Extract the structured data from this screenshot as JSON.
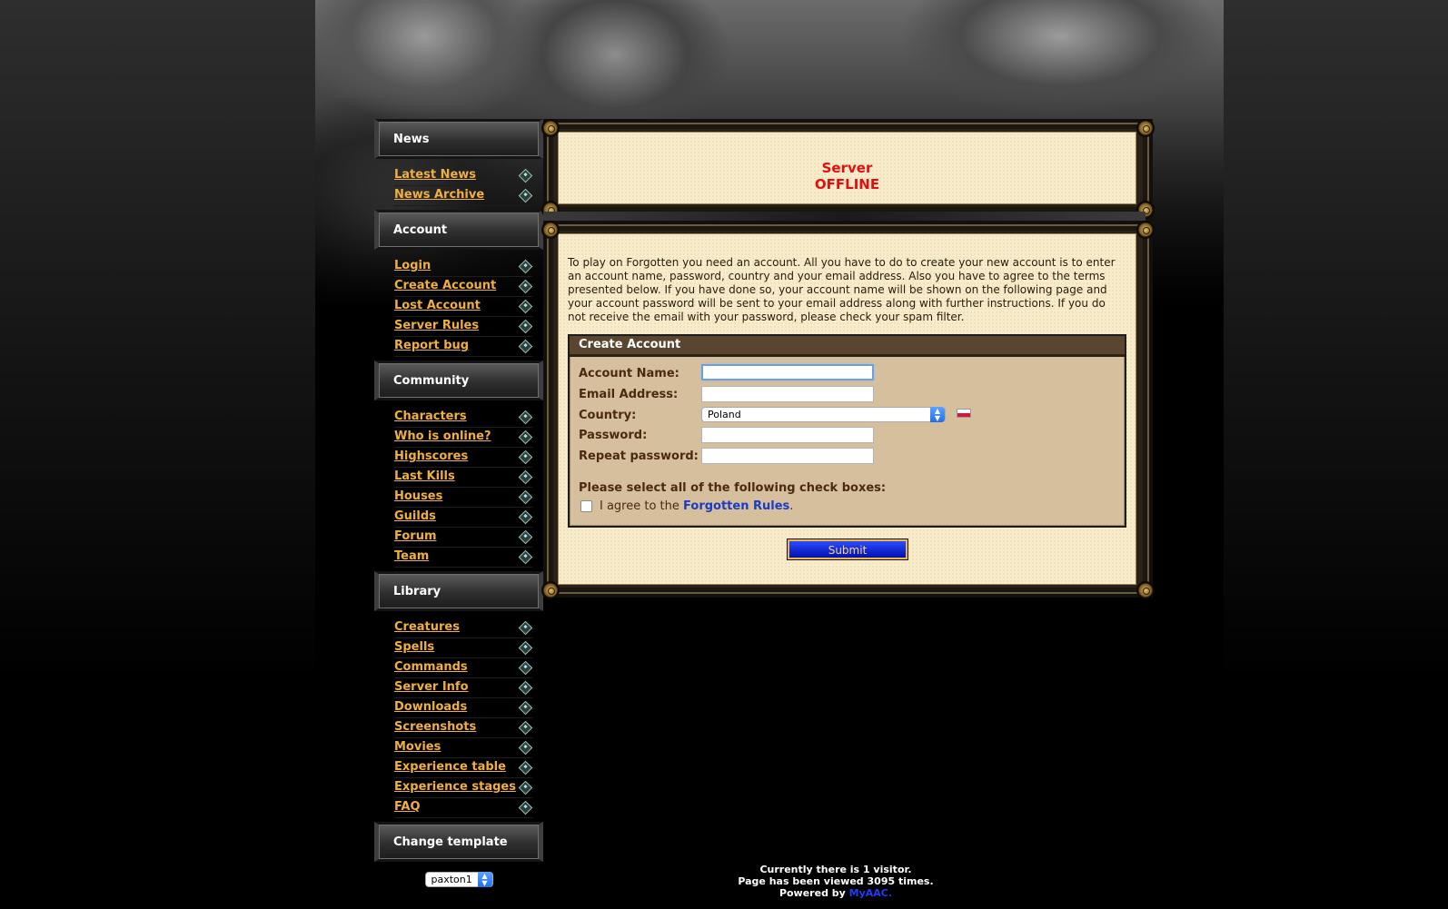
{
  "sidebar": {
    "sections": [
      {
        "title": "News",
        "items": [
          "Latest News",
          "News Archive"
        ]
      },
      {
        "title": "Account",
        "items": [
          "Login",
          "Create Account",
          "Lost Account",
          "Server Rules",
          "Report bug"
        ]
      },
      {
        "title": "Community",
        "items": [
          "Characters",
          "Who is online?",
          "Highscores",
          "Last Kills",
          "Houses",
          "Guilds",
          "Forum",
          "Team"
        ]
      },
      {
        "title": "Library",
        "items": [
          "Creatures",
          "Spells",
          "Commands",
          "Server Info",
          "Downloads",
          "Screenshots",
          "Movies",
          "Experience table",
          "Experience stages",
          "FAQ"
        ]
      }
    ],
    "change_template": {
      "title": "Change template",
      "selected": "paxton1"
    }
  },
  "status": {
    "line1": "Server",
    "line2": "OFFLINE"
  },
  "main": {
    "intro": "To play on Forgotten you need an account. All you have to do to create your new account is to enter an account name, password, country and your email address. Also you have to agree to the terms presented below. If you have done so, your account name will be shown on the following page and your account password will be sent to your email address along with further instructions. If you do not receive the email with your password, please check your spam filter.",
    "form": {
      "title": "Create Account",
      "account_name_label": "Account Name:",
      "email_label": "Email Address:",
      "country_label": "Country:",
      "country_selected": "Poland",
      "password_label": "Password:",
      "repeat_password_label": "Repeat password:",
      "checkbox_title": "Please select all of the following check boxes:",
      "agree_prefix": "I agree to the",
      "agree_link": "Forgotten Rules",
      "agree_suffix": "."
    },
    "submit_label": "Submit"
  },
  "footer": {
    "line1": "Currently there is 1 visitor.",
    "line2": "Page has been viewed 3095 times.",
    "line3_prefix": "Powered by",
    "line3_link": "MyAAC."
  },
  "colors": {
    "link": "#f0b040",
    "offline": "#e01010",
    "form_header": "#5a4630"
  }
}
